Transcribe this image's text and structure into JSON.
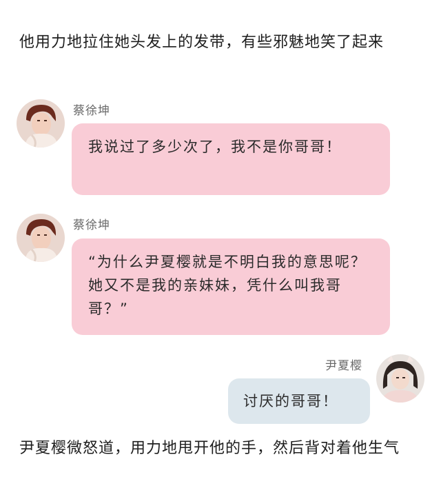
{
  "narration": {
    "top": "他用力地拉住她头发上的发带，有些邪魅地笑了起来",
    "bottom": "尹夏樱微怒道，用力地甩开他的手，然后背对着他生气"
  },
  "messages": [
    {
      "sender": "蔡徐坤",
      "text": "我说过了多少次了，我不是你哥哥！",
      "side": "left"
    },
    {
      "sender": "蔡徐坤",
      "text": "“为什么尹夏樱就是不明白我的意思呢？她又不是我的亲妹妹，凭什么叫我哥哥？”",
      "side": "left"
    },
    {
      "sender": "尹夏樱",
      "text": "讨厌的哥哥！",
      "side": "right"
    }
  ],
  "colors": {
    "left_bubble": "#f9ccd6",
    "right_bubble": "#dde7ed",
    "name_text": "#6a6a6a"
  },
  "icons": {
    "male_avatar": "avatar-photo-boy",
    "female_avatar": "avatar-photo-girl"
  }
}
